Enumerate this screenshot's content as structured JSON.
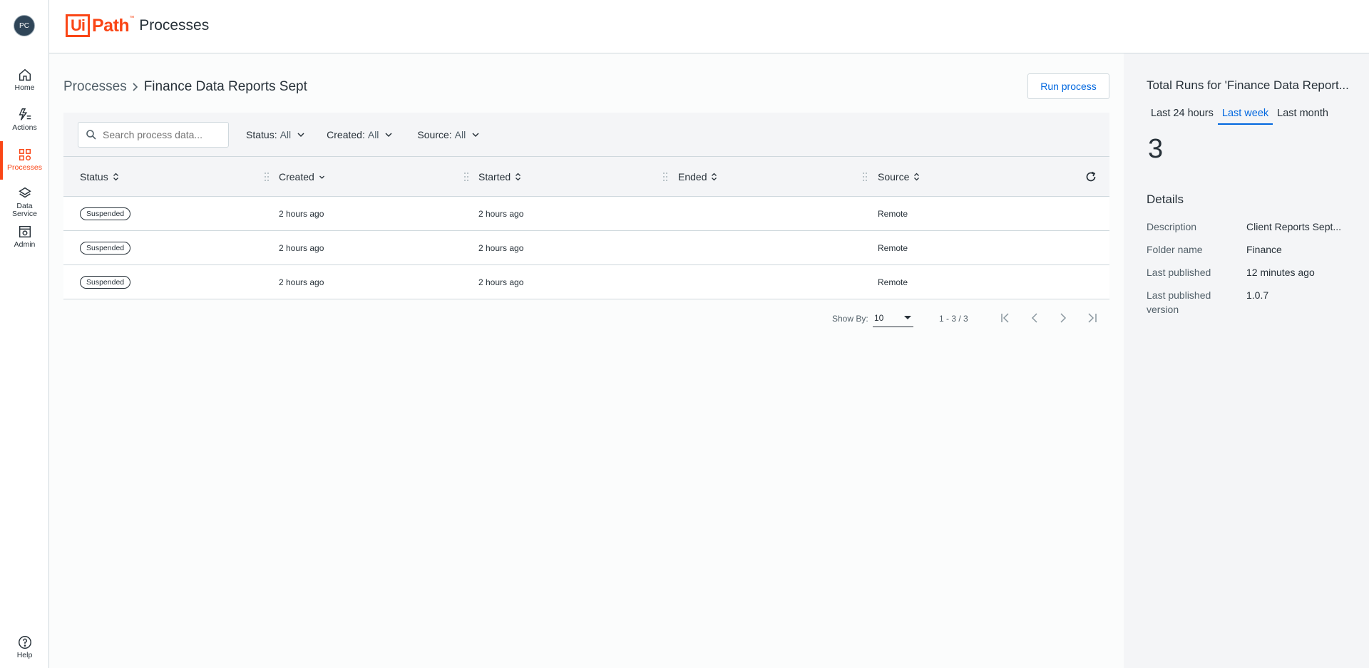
{
  "user": {
    "initials": "PC"
  },
  "nav": {
    "home": "Home",
    "actions": "Actions",
    "processes": "Processes",
    "data_service": "Data Service",
    "admin": "Admin",
    "help": "Help"
  },
  "header": {
    "logo_ui": "Ui",
    "logo_path": "Path",
    "logo_tm": "™",
    "title": "Processes"
  },
  "breadcrumb": {
    "root": "Processes",
    "separator": ">",
    "current": "Finance Data Reports Sept"
  },
  "actions": {
    "run_process": "Run process"
  },
  "search": {
    "placeholder": "Search process data..."
  },
  "filters": [
    {
      "label": "Status:",
      "value": "All"
    },
    {
      "label": "Created:",
      "value": "All"
    },
    {
      "label": "Source:",
      "value": "All"
    }
  ],
  "table": {
    "columns": [
      "Status",
      "Created",
      "Started",
      "Ended",
      "Source"
    ],
    "rows": [
      {
        "status": "Suspended",
        "created": "2 hours ago",
        "started": "2 hours ago",
        "ended": "",
        "source": "Remote"
      },
      {
        "status": "Suspended",
        "created": "2 hours ago",
        "started": "2 hours ago",
        "ended": "",
        "source": "Remote"
      },
      {
        "status": "Suspended",
        "created": "2 hours ago",
        "started": "2 hours ago",
        "ended": "",
        "source": "Remote"
      }
    ]
  },
  "pager": {
    "show_by_label": "Show By:",
    "page_size": "10",
    "range": "1 - 3 / 3"
  },
  "side": {
    "title": "Total Runs for 'Finance Data Report...",
    "tabs": [
      "Last 24 hours",
      "Last week",
      "Last month"
    ],
    "active_tab": "Last week",
    "total_runs": "3",
    "details_heading": "Details",
    "details": [
      {
        "label": "Description",
        "value": "Client Reports Sept..."
      },
      {
        "label": "Folder name",
        "value": "Finance"
      },
      {
        "label": "Last published",
        "value": "12 minutes ago"
      },
      {
        "label": "Last published version",
        "value": "1.0.7"
      }
    ]
  },
  "colors": {
    "brand": "#fa4616",
    "accent": "#0067df",
    "text": "#273139"
  }
}
